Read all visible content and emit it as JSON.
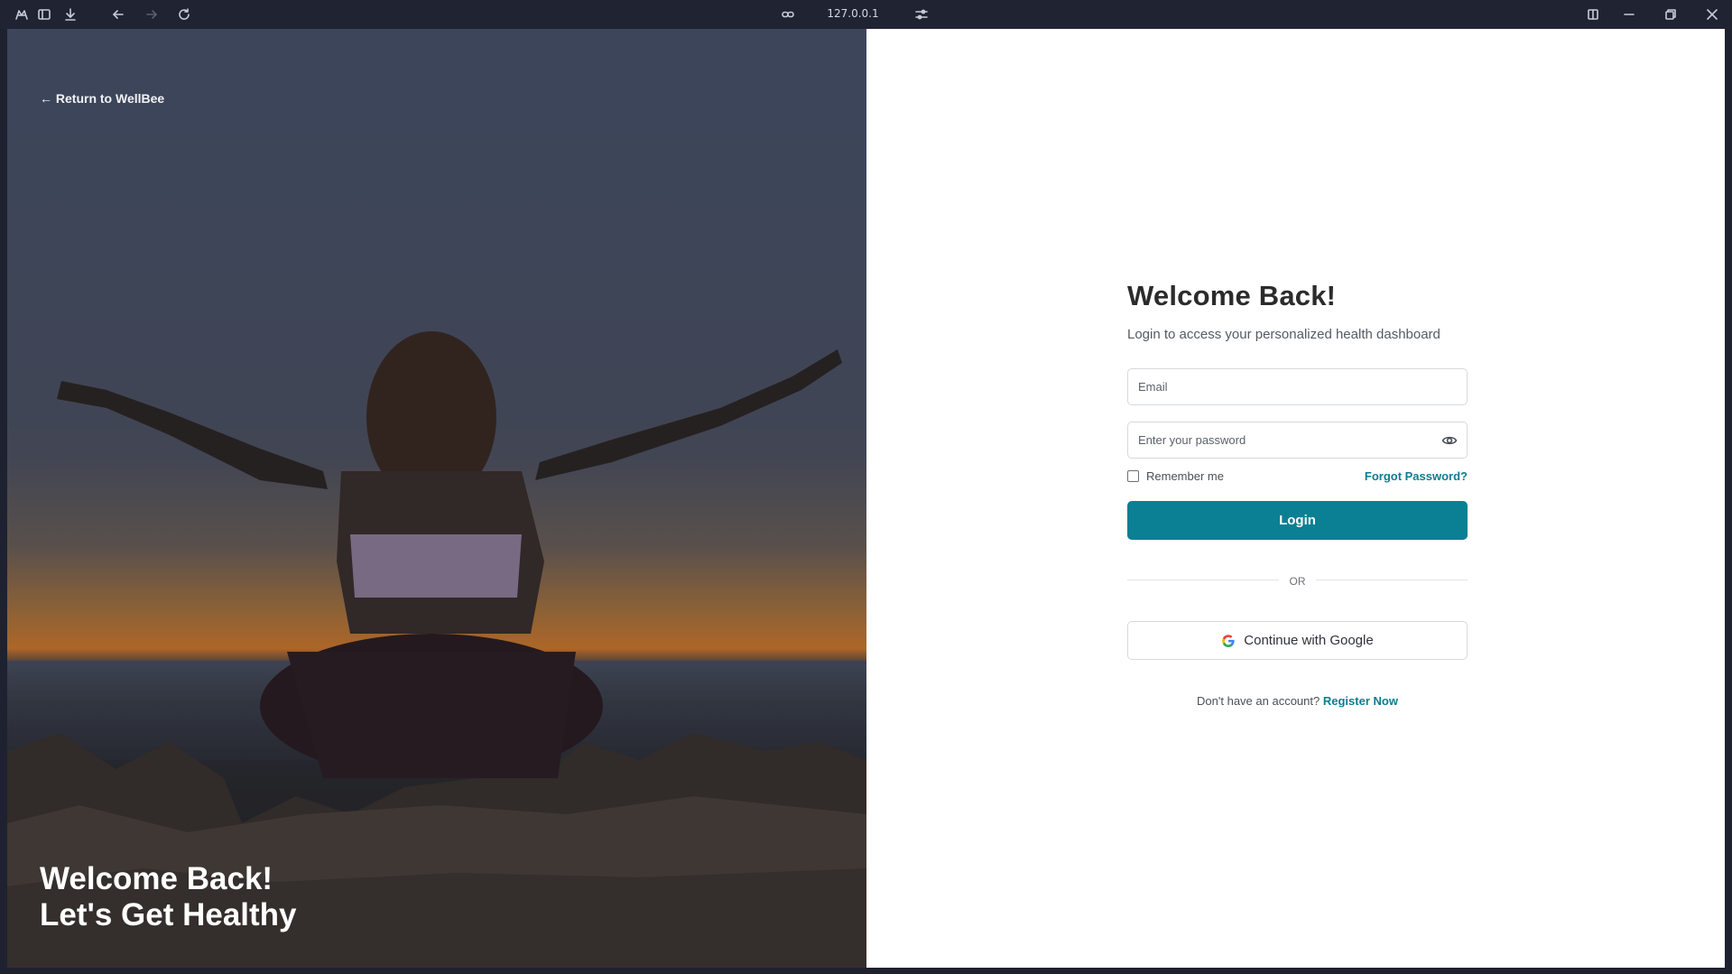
{
  "browser": {
    "url": "127.0.0.1",
    "icons": [
      "app-logo-icon",
      "sidebar-toggle-icon",
      "download-icon",
      "back-arrow-icon",
      "forward-arrow-icon",
      "reload-icon",
      "link-icon",
      "settings-sliders-icon",
      "split-view-icon",
      "minimize-icon",
      "restore-icon",
      "close-icon"
    ]
  },
  "hero": {
    "back_link": "← Return to WellBee",
    "title_line1": "Welcome Back!",
    "title_line2": "Let's Get Healthy"
  },
  "login": {
    "title": "Welcome Back!",
    "subtitle": "Login to access your personalized health dashboard",
    "email_placeholder": "Email",
    "password_placeholder": "Enter your password",
    "remember_label": "Remember me",
    "forgot_label": "Forgot Password?",
    "login_label": "Login",
    "divider_text": "OR",
    "google_label": "Continue with Google",
    "register_prompt": "Don't have an account?",
    "register_link": "Register Now"
  },
  "colors": {
    "accent": "#0b7f93",
    "link": "#0e7c8f",
    "chrome_bg": "#1f2332"
  }
}
